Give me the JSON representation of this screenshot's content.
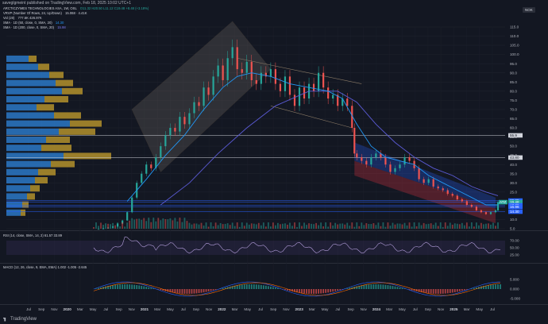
{
  "header": {
    "published": "saveglgmeint published on TradingView.com, Feb 18, 2025 10:02 UTC+1",
    "symbol_line": "ARCTICZYMES TECHNOLOGIES ASA, 1W, OSL",
    "ohlc_text": "O11.32 H20.50 L11.12 C19.48 +8.48 (+3.18%)",
    "currency": "NOK"
  },
  "indicators": [
    {
      "name": "VRVP (Number Of Rows, 24, Up/Down)",
      "values": "15.068 · 4.41K",
      "color": "#d1d4dc"
    },
    {
      "name": "Vol (20)",
      "values": "777.6K  426.97K",
      "color": "#d1d4dc"
    },
    {
      "name": "SMA · 1D (50, close, 0, SMA, 20)",
      "values": "14.30",
      "color": "#2196f3"
    },
    {
      "name": "SMA · 1D (200, close, 0, SMA, 20)",
      "values": "15.98",
      "color": "#5b5bd6"
    }
  ],
  "rsi_label": "RSI (14, close, SMA, 14, 2)  61.57  33.89",
  "macd_label": "MACD (12, 26, close, 9, EMA, EMA)  1.002  -1.005  -2.645",
  "brand": "TradingView",
  "chart_data": {
    "type": "candlestick",
    "x_tick_labels": [
      "Jul",
      "Sep",
      "Nov",
      "2020",
      "Mar",
      "May",
      "Jul",
      "Sep",
      "Nov",
      "2021",
      "Mar",
      "May",
      "Jul",
      "Sep",
      "Nov",
      "2022",
      "Mar",
      "May",
      "Jul",
      "Sep",
      "Nov",
      "2023",
      "Mar",
      "May",
      "Jul",
      "Sep",
      "Nov",
      "2024",
      "Mar",
      "May",
      "Jul",
      "Sep",
      "Nov",
      "2025",
      "Mar",
      "May",
      "Jul"
    ],
    "y_tick_labels": [
      "115.0",
      "110.0",
      "105.0",
      "100.0",
      "95.0",
      "90.0",
      "85.0",
      "80.0",
      "75.0",
      "70.0",
      "65.0",
      "60.0",
      "55.0",
      "50.0",
      "45.0",
      "40.0",
      "35.0",
      "30.0",
      "25.0",
      "20.0",
      "15.0",
      "10.0",
      "5.0"
    ],
    "y_range": [
      5,
      115
    ],
    "price_levels": [
      {
        "label": "55.9",
        "value": 55.9
      },
      {
        "label": "43.80",
        "value": 43.8
      },
      {
        "label": "20.35",
        "value": 20.35
      },
      {
        "label": "19.48",
        "value": 19.48
      },
      {
        "label": "17.75",
        "value": 17.75
      },
      {
        "label": "16.96",
        "value": 16.96
      },
      {
        "label": "14.30",
        "value": 14.3
      }
    ],
    "current_price_tag": "ATZ",
    "price_series": [
      [
        0,
        4.6
      ],
      [
        2,
        4.8
      ],
      [
        4,
        5.2
      ],
      [
        6,
        5.6
      ],
      [
        8,
        6.2
      ],
      [
        10,
        7.8
      ],
      [
        12,
        9.5
      ],
      [
        14,
        14
      ],
      [
        16,
        22
      ],
      [
        18,
        30
      ],
      [
        20,
        35
      ],
      [
        22,
        40
      ],
      [
        24,
        38
      ],
      [
        26,
        44
      ],
      [
        28,
        50
      ],
      [
        30,
        56
      ],
      [
        32,
        60
      ],
      [
        34,
        58
      ],
      [
        36,
        66
      ],
      [
        38,
        62
      ],
      [
        40,
        68
      ],
      [
        42,
        74
      ],
      [
        44,
        72
      ],
      [
        46,
        82
      ],
      [
        48,
        78
      ],
      [
        50,
        88
      ],
      [
        52,
        94
      ],
      [
        54,
        86
      ],
      [
        56,
        98
      ],
      [
        58,
        104
      ],
      [
        60,
        92
      ],
      [
        62,
        90
      ],
      [
        64,
        96
      ],
      [
        66,
        86
      ],
      [
        68,
        84
      ],
      [
        70,
        90
      ],
      [
        72,
        88
      ],
      [
        74,
        92
      ],
      [
        76,
        84
      ],
      [
        78,
        80
      ],
      [
        80,
        88
      ],
      [
        82,
        78
      ],
      [
        84,
        72
      ],
      [
        86,
        82
      ],
      [
        88,
        76
      ],
      [
        90,
        84
      ],
      [
        92,
        80
      ],
      [
        94,
        90
      ],
      [
        96,
        82
      ],
      [
        98,
        76
      ],
      [
        100,
        78
      ],
      [
        102,
        72
      ],
      [
        104,
        76
      ],
      [
        106,
        72
      ],
      [
        108,
        60
      ],
      [
        109,
        46
      ],
      [
        110,
        44
      ],
      [
        112,
        42
      ],
      [
        114,
        40
      ],
      [
        116,
        44
      ],
      [
        118,
        46
      ],
      [
        120,
        44
      ],
      [
        122,
        40
      ],
      [
        124,
        36
      ],
      [
        126,
        38
      ],
      [
        128,
        40
      ],
      [
        130,
        44
      ],
      [
        132,
        42
      ],
      [
        134,
        38
      ],
      [
        136,
        32
      ],
      [
        138,
        30
      ],
      [
        140,
        32
      ],
      [
        142,
        28
      ],
      [
        144,
        27
      ],
      [
        146,
        26
      ],
      [
        148,
        24
      ],
      [
        150,
        23
      ],
      [
        152,
        21
      ],
      [
        154,
        20
      ],
      [
        156,
        18
      ],
      [
        158,
        17
      ],
      [
        160,
        15
      ],
      [
        162,
        14
      ],
      [
        164,
        13
      ],
      [
        166,
        14
      ],
      [
        168,
        15
      ],
      [
        169,
        19.48
      ]
    ],
    "sma50_series": [
      [
        14,
        20
      ],
      [
        22,
        32
      ],
      [
        30,
        45
      ],
      [
        38,
        56
      ],
      [
        46,
        70
      ],
      [
        54,
        82
      ],
      [
        60,
        88
      ],
      [
        66,
        90
      ],
      [
        74,
        88
      ],
      [
        82,
        84
      ],
      [
        90,
        82
      ],
      [
        98,
        80
      ],
      [
        104,
        76
      ],
      [
        110,
        62
      ],
      [
        116,
        50
      ],
      [
        122,
        44
      ],
      [
        128,
        42
      ],
      [
        134,
        40
      ],
      [
        140,
        34
      ],
      [
        146,
        30
      ],
      [
        152,
        26
      ],
      [
        158,
        22
      ],
      [
        164,
        18
      ],
      [
        169,
        18
      ]
    ],
    "sma200_series": [
      [
        28,
        18
      ],
      [
        40,
        30
      ],
      [
        52,
        46
      ],
      [
        64,
        60
      ],
      [
        76,
        72
      ],
      [
        90,
        80
      ],
      [
        102,
        80
      ],
      [
        110,
        74
      ],
      [
        118,
        62
      ],
      [
        126,
        52
      ],
      [
        134,
        44
      ],
      [
        142,
        38
      ],
      [
        150,
        34
      ],
      [
        158,
        28
      ],
      [
        164,
        25
      ],
      [
        169,
        23
      ]
    ]
  }
}
